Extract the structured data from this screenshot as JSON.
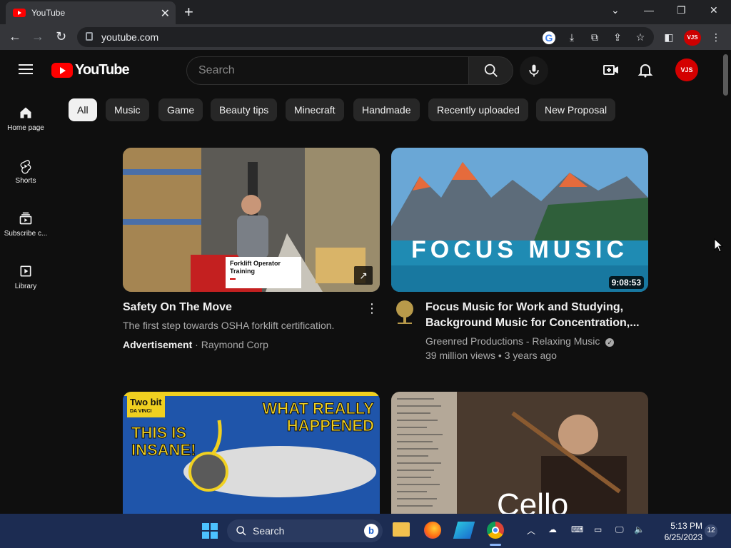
{
  "browser": {
    "tab_title": "YouTube",
    "url": "youtube.com",
    "profile_initials": "VJS"
  },
  "header": {
    "logo_text": "YouTube",
    "search_placeholder": "Search",
    "avatar_initials": "VJS"
  },
  "sidebar": {
    "items": [
      {
        "label": "Home page",
        "icon": "home-icon"
      },
      {
        "label": "Shorts",
        "icon": "shorts-icon"
      },
      {
        "label": "Subscribe c...",
        "icon": "subscriptions-icon"
      },
      {
        "label": "Library",
        "icon": "library-icon"
      }
    ]
  },
  "chips": [
    "All",
    "Music",
    "Game",
    "Beauty tips",
    "Minecraft",
    "Handmade",
    "Recently uploaded",
    "New Proposal"
  ],
  "videos": [
    {
      "title": "Safety On The Move",
      "description": "The first step towards OSHA forklift certification.",
      "ad_label": "Advertisement",
      "advertiser": " · Raymond Corp",
      "thumb_caption_1": "Forklift Operator",
      "thumb_caption_2": "Training"
    },
    {
      "title_line1": "Focus Music for Work and Studying,",
      "title_line2": "Background Music for Concentration,...",
      "channel": "Greenred Productions - Relaxing Music",
      "stats": "39 million views • 3 years ago",
      "duration": "9:08:53",
      "thumb_text": "FOCUS MUSIC"
    },
    {
      "thumb_text_1": "WHAT REALLY",
      "thumb_text_2": "HAPPENED",
      "thumb_text_3": "THIS IS",
      "thumb_text_4": "INSANE!",
      "thumb_brand": "Two bit",
      "thumb_brand_sub": "DA VINCI"
    },
    {
      "thumb_text": "Cello"
    }
  ],
  "taskbar": {
    "search_label": "Search",
    "time": "5:13 PM",
    "date": "6/25/2023",
    "notifications": "12"
  },
  "colors": {
    "background": "#0f0f0f",
    "brand_red": "#ff0000",
    "chip_bg": "#272727",
    "taskbar": "#1c2c52"
  }
}
